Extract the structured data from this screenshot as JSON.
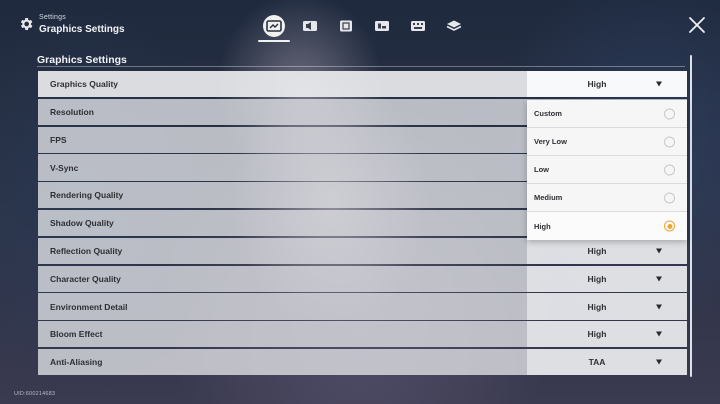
{
  "header": {
    "crumb_small": "Settings",
    "crumb_title": "Graphics Settings",
    "tabs": [
      {
        "icon": "display-icon",
        "active": true
      },
      {
        "icon": "audio-icon",
        "active": false
      },
      {
        "icon": "language-icon",
        "active": false
      },
      {
        "icon": "controls-icon",
        "active": false
      },
      {
        "icon": "keyboard-icon",
        "active": false
      },
      {
        "icon": "other-icon",
        "active": false
      }
    ]
  },
  "section_title": "Graphics Settings",
  "rows": [
    {
      "label": "Graphics Quality",
      "value": "High"
    },
    {
      "label": "Resolution",
      "value": ""
    },
    {
      "label": "FPS",
      "value": ""
    },
    {
      "label": "V-Sync",
      "value": ""
    },
    {
      "label": "Rendering Quality",
      "value": ""
    },
    {
      "label": "Shadow Quality",
      "value": ""
    },
    {
      "label": "Reflection Quality",
      "value": "High"
    },
    {
      "label": "Character Quality",
      "value": "High"
    },
    {
      "label": "Environment Detail",
      "value": "High"
    },
    {
      "label": "Bloom Effect",
      "value": "High"
    },
    {
      "label": "Anti-Aliasing",
      "value": "TAA"
    }
  ],
  "dropdown": {
    "options": [
      {
        "label": "Custom",
        "selected": false
      },
      {
        "label": "Very Low",
        "selected": false
      },
      {
        "label": "Low",
        "selected": false
      },
      {
        "label": "Medium",
        "selected": false
      },
      {
        "label": "High",
        "selected": true
      }
    ]
  },
  "uid": "UID:600214683",
  "colors": {
    "accent": "#e9a535",
    "row_bg": "#dadce0",
    "text": "#2e2f33"
  }
}
